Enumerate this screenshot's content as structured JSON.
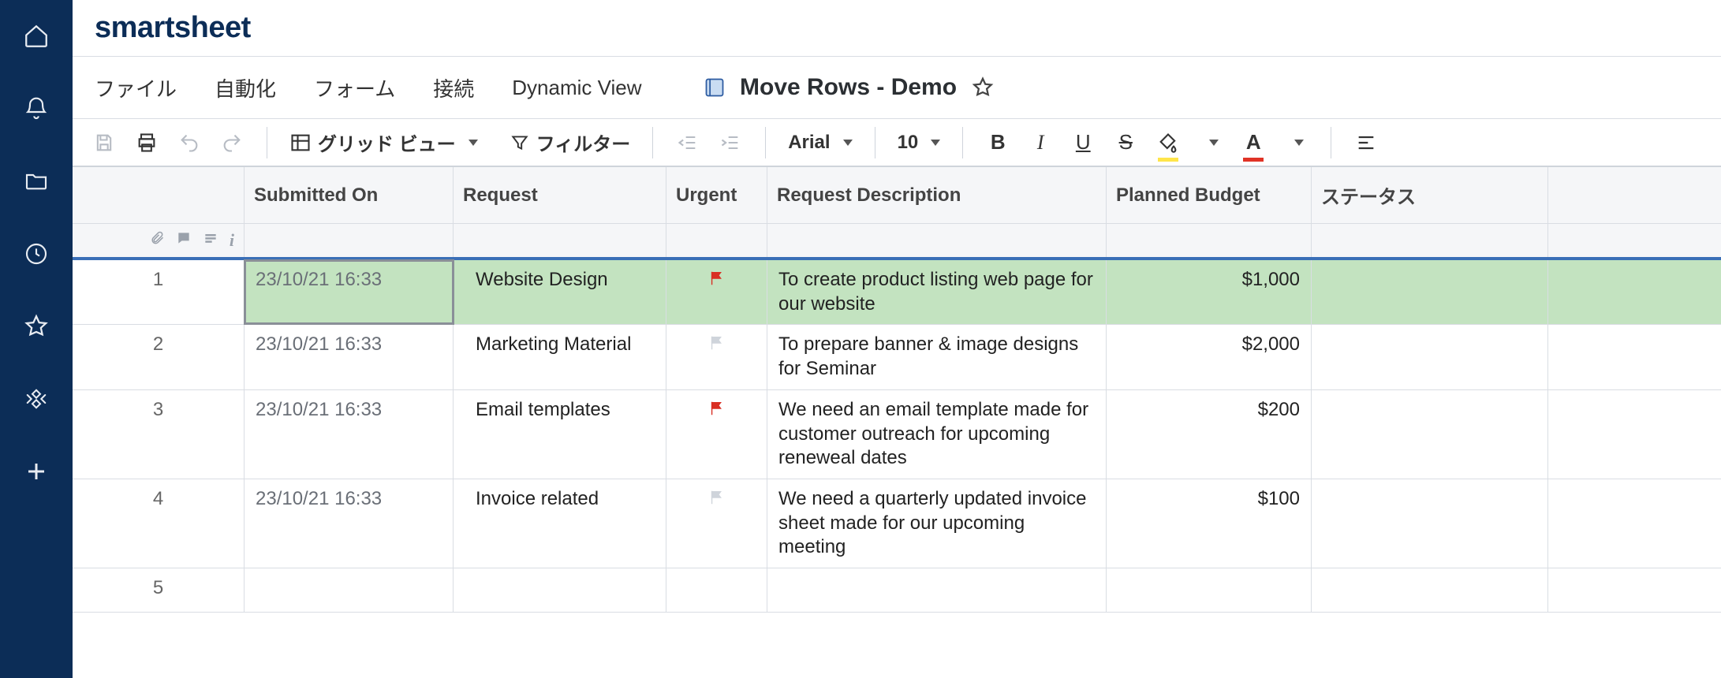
{
  "brand": {
    "logo": "smartsheet"
  },
  "menu": {
    "file": "ファイル",
    "automation": "自動化",
    "form": "フォーム",
    "connect": "接続",
    "dynamic_view": "Dynamic View"
  },
  "sheet": {
    "title": "Move Rows - Demo"
  },
  "toolbar": {
    "view_label": "グリッド ビュー",
    "filter_label": "フィルター",
    "font_name": "Arial",
    "font_size": "10"
  },
  "columns": {
    "submitted_on": "Submitted On",
    "request": "Request",
    "urgent": "Urgent",
    "description": "Request Description",
    "budget": "Planned Budget",
    "status": "ステータス"
  },
  "rows": [
    {
      "num": "1",
      "submitted": "23/10/21 16:33",
      "request": "Website Design",
      "urgent": true,
      "description": "To create product listing web page for our website",
      "budget": "$1,000",
      "status": ""
    },
    {
      "num": "2",
      "submitted": "23/10/21 16:33",
      "request": "Marketing Material",
      "urgent": false,
      "description": "To prepare banner & image designs for Seminar",
      "budget": "$2,000",
      "status": ""
    },
    {
      "num": "3",
      "submitted": "23/10/21 16:33",
      "request": "Email templates",
      "urgent": true,
      "description": "We need an email template made for customer outreach for upcoming reneweal dates",
      "budget": "$200",
      "status": ""
    },
    {
      "num": "4",
      "submitted": "23/10/21 16:33",
      "request": "Invoice related",
      "urgent": false,
      "description": "We need a quarterly updated invoice sheet made for our upcoming meeting",
      "budget": "$100",
      "status": ""
    },
    {
      "num": "5",
      "submitted": "",
      "request": "",
      "urgent": null,
      "description": "",
      "budget": "",
      "status": ""
    }
  ]
}
